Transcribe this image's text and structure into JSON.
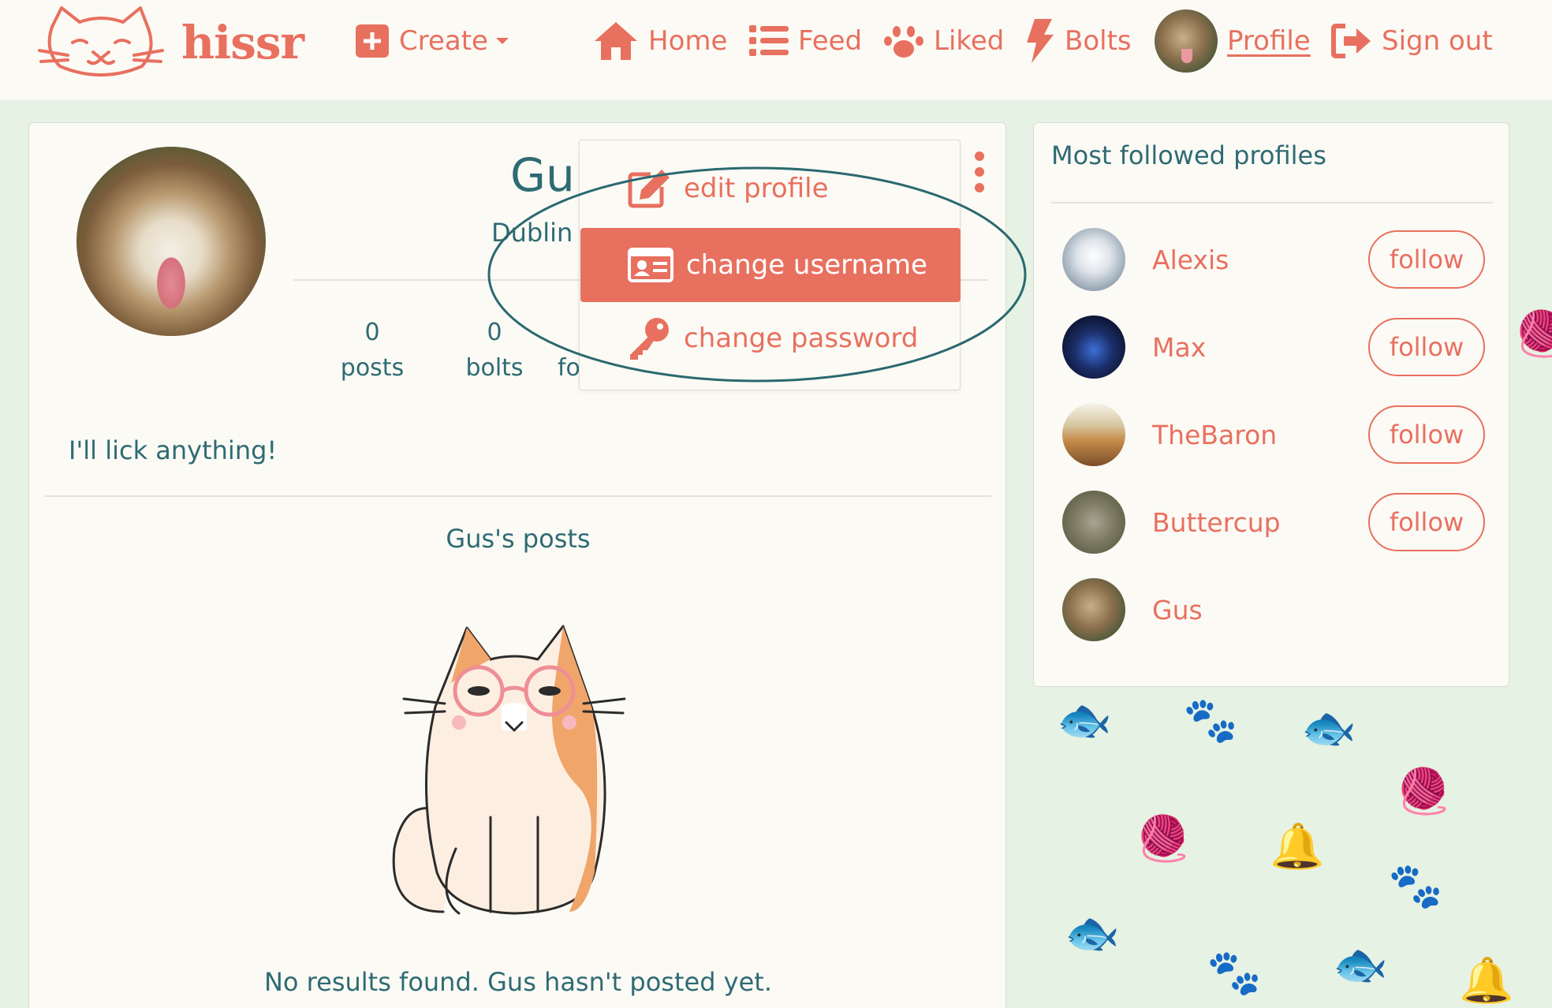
{
  "colors": {
    "accent": "#e8705f",
    "text": "#2e6b73",
    "background": "#e6f2e3",
    "card": "#fcfaf5"
  },
  "brand": {
    "name": "hissr"
  },
  "nav": {
    "create": {
      "label": "Create",
      "icon": "plus-square-icon"
    },
    "home": {
      "label": "Home",
      "icon": "home-icon"
    },
    "feed": {
      "label": "Feed",
      "icon": "list-icon"
    },
    "liked": {
      "label": "Liked",
      "icon": "paw-icon"
    },
    "bolts": {
      "label": "Bolts",
      "icon": "bolt-icon"
    },
    "profile": {
      "label": "Profile",
      "icon": "avatar"
    },
    "signout": {
      "label": "Sign out",
      "icon": "sign-out-icon"
    }
  },
  "profile": {
    "name": "Gu",
    "location": "Dublin",
    "stats": [
      {
        "value": "0",
        "label": "posts"
      },
      {
        "value": "0",
        "label": "bolts"
      },
      {
        "value": "",
        "label": "fo"
      }
    ],
    "bio": "I'll lick anything!",
    "posts_heading": "Gus's posts",
    "empty_message": "No results found. Gus hasn't posted yet."
  },
  "dropdown": {
    "items": [
      {
        "label": "edit profile",
        "icon": "edit-icon"
      },
      {
        "label": "change username",
        "icon": "id-card-icon",
        "active": true
      },
      {
        "label": "change password",
        "icon": "key-icon"
      }
    ]
  },
  "sidebar": {
    "title": "Most followed profiles",
    "profiles": [
      {
        "name": "Alexis",
        "button": "follow"
      },
      {
        "name": "Max",
        "button": "follow"
      },
      {
        "name": "TheBaron",
        "button": "follow"
      },
      {
        "name": "Buttercup",
        "button": "follow"
      },
      {
        "name": "Gus",
        "button": ""
      }
    ]
  }
}
